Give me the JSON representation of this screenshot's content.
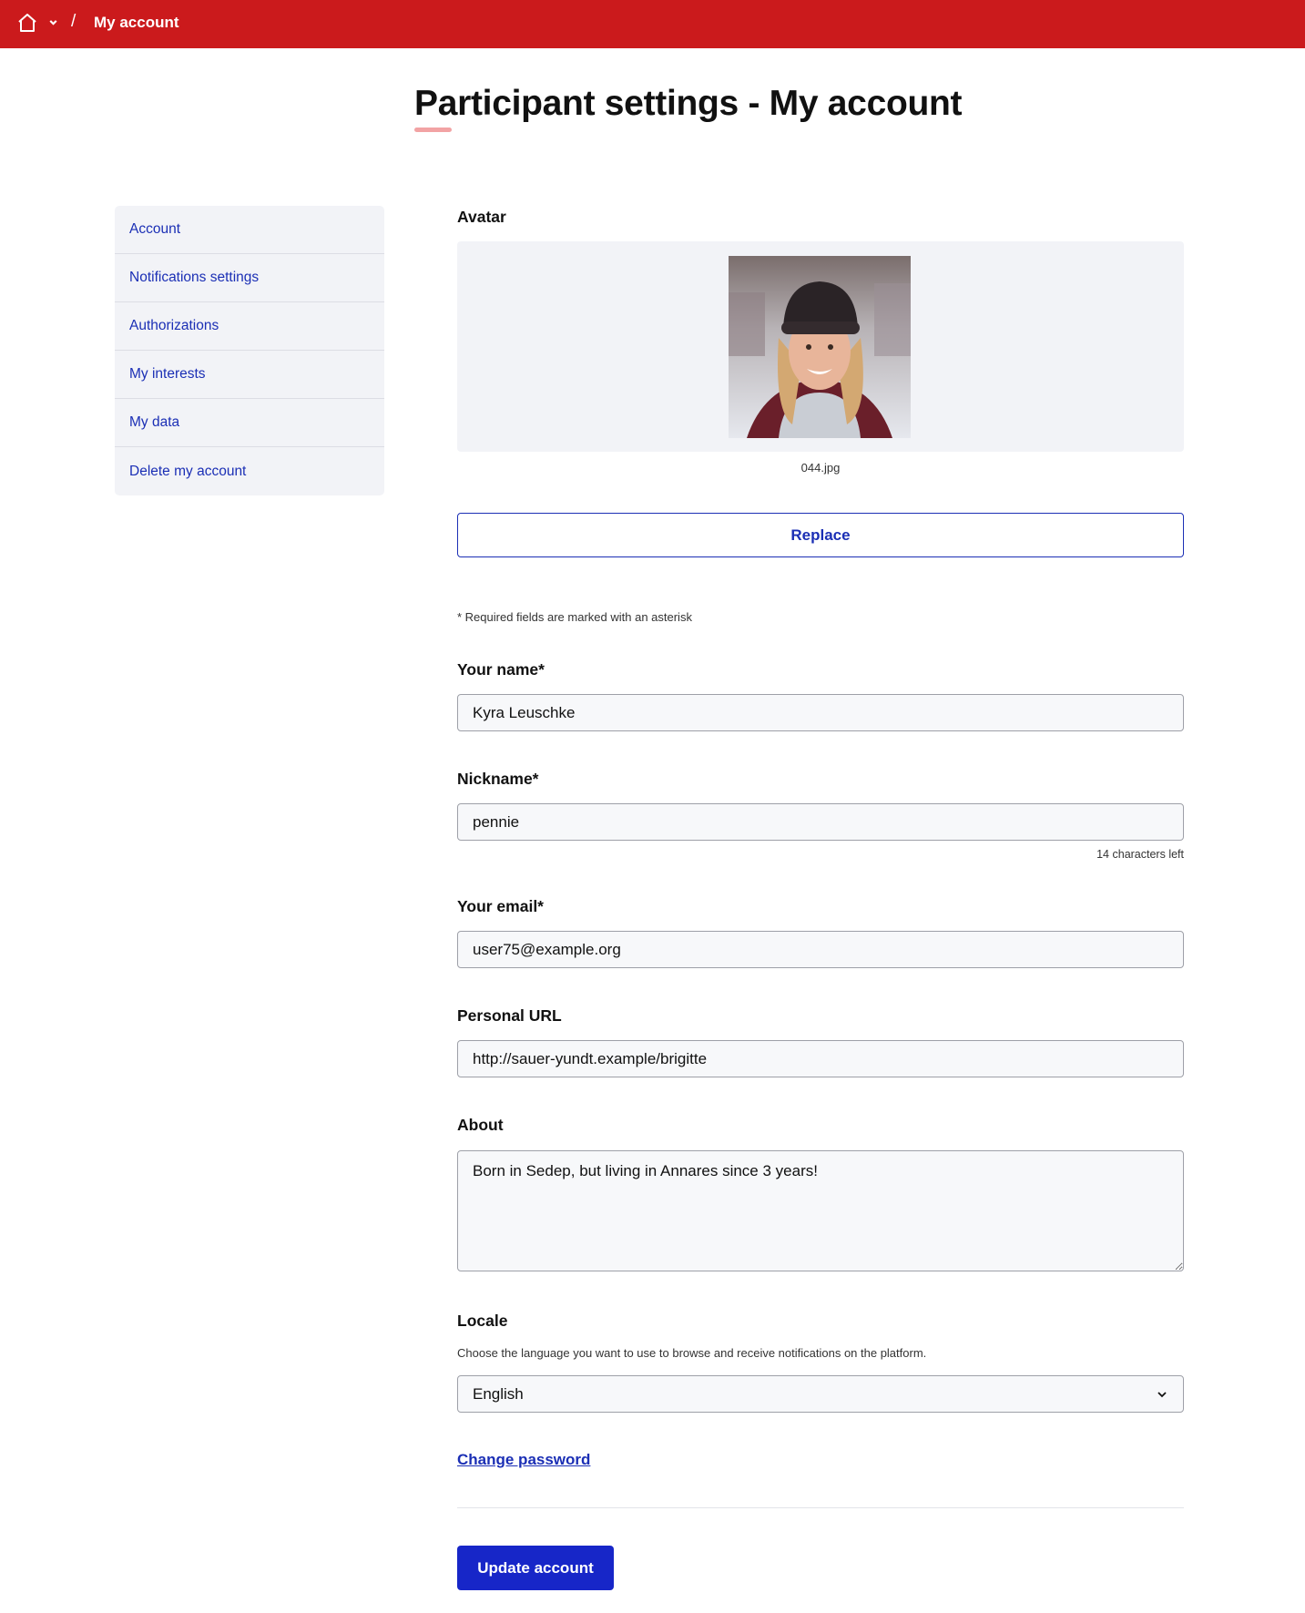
{
  "breadcrumb": {
    "separator": "/",
    "current": "My account"
  },
  "page_title": "Participant settings - My account",
  "sidebar": {
    "items": [
      {
        "label": "Account"
      },
      {
        "label": "Notifications settings"
      },
      {
        "label": "Authorizations"
      },
      {
        "label": "My interests"
      },
      {
        "label": "My data"
      },
      {
        "label": "Delete my account"
      }
    ]
  },
  "avatar": {
    "label": "Avatar",
    "filename": "044.jpg",
    "replace_label": "Replace"
  },
  "form": {
    "required_note": "* Required fields are marked with an asterisk",
    "name": {
      "label": "Your name*",
      "value": "Kyra Leuschke"
    },
    "nickname": {
      "label": "Nickname*",
      "value": "pennie",
      "chars_left": "14 characters left"
    },
    "email": {
      "label": "Your email*",
      "value": "user75@example.org"
    },
    "personal_url": {
      "label": "Personal URL",
      "value": "http://sauer-yundt.example/brigitte"
    },
    "about": {
      "label": "About",
      "value": "Born in Sedep, but living in Annares since 3 years!"
    },
    "locale": {
      "label": "Locale",
      "help": "Choose the language you want to use to browse and receive notifications on the platform.",
      "value": "English"
    },
    "change_password": "Change password",
    "submit": "Update account"
  },
  "colors": {
    "topbar": "#cb1a1c",
    "link": "#1b2fb5",
    "primary_button": "#1726c8"
  },
  "icons": {
    "home": "home-icon",
    "dropdown": "chevron-down-icon"
  }
}
